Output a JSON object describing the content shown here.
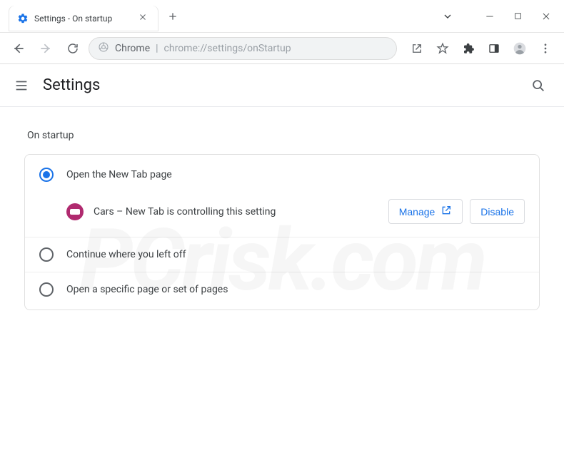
{
  "window": {
    "tab_title": "Settings - On startup"
  },
  "omnibox": {
    "scheme_label": "Chrome",
    "url_path": "chrome://settings/onStartup"
  },
  "header": {
    "title": "Settings"
  },
  "section": {
    "title": "On startup"
  },
  "options": [
    {
      "label": "Open the New Tab page",
      "checked": true
    },
    {
      "label": "Continue where you left off",
      "checked": false
    },
    {
      "label": "Open a specific page or set of pages",
      "checked": false
    }
  ],
  "managed": {
    "extension_name": "Cars – New Tab",
    "message_suffix": " is controlling this setting",
    "manage_label": "Manage",
    "disable_label": "Disable"
  },
  "watermark": "PCrisk.com"
}
